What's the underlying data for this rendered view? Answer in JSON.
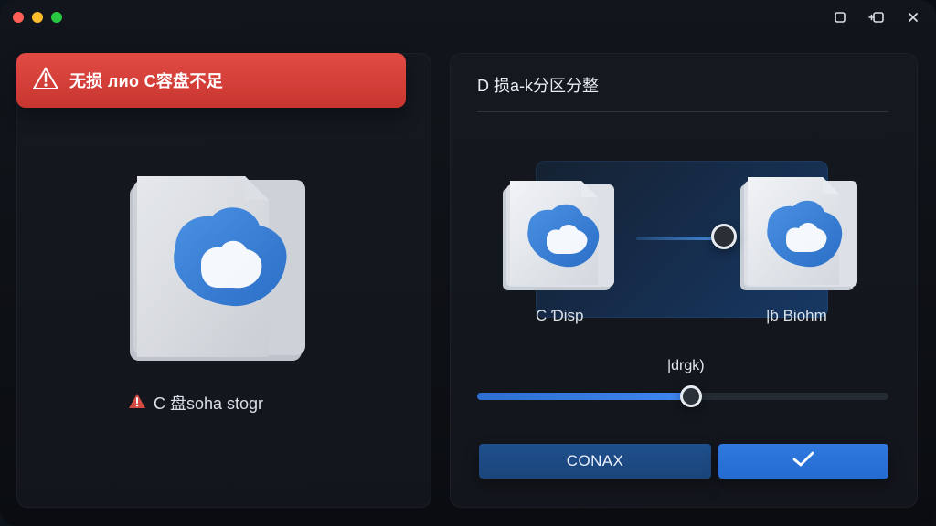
{
  "theme": {
    "accent": "#2f79df",
    "alert": "#e14b44"
  },
  "titlebar": {
    "icons": [
      "close-dot",
      "minimize-dot",
      "zoom-dot",
      "window-icon",
      "snap-icon",
      "close-icon"
    ]
  },
  "left_panel": {
    "alert_text": "无损 лио C容盘不足",
    "status_text": "C 盘soha stogr",
    "drive_icon": "drive-cloud-icon"
  },
  "right_panel": {
    "title": "D 损a-k分区分整",
    "left_drive_label": "C Ɗisp",
    "right_drive_label": "|ɓ Biohm",
    "slider_label": "|drgk)",
    "slider_value": 0.52,
    "cancel_label": "CONAX",
    "confirm_label": "✓"
  }
}
